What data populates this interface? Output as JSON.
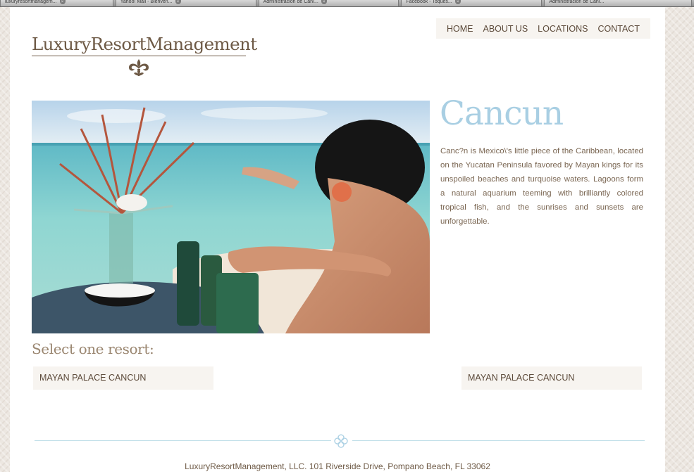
{
  "browser": {
    "tabs": [
      {
        "label": "luxuryresortmanagem..."
      },
      {
        "label": "Yahoo! Mail - Bienven..."
      },
      {
        "label": "Administración de Caní..."
      },
      {
        "label": "Facebook - Toques..."
      },
      {
        "label": "Administración de Caní..."
      }
    ]
  },
  "logo": {
    "text": "LuxuryResortManagement"
  },
  "nav": {
    "home": "HOME",
    "about": "ABOUT US",
    "locations": "LOCATIONS",
    "contact": "CONTACT"
  },
  "location": {
    "title": "Cancun",
    "description": "Canc?n is Mexico\\'s little piece of the Caribbean, located on the Yucatan Peninsula favored by Mayan kings for its unspoiled beaches and turquoise waters. Lagoons form a natural aquarium teeming with brilliantly colored tropical fish, and the sunrises and sunsets are unforgettable."
  },
  "select": {
    "heading": "Select one resort:",
    "resorts": [
      {
        "label": "MAYAN PALACE CANCUN"
      },
      {
        "label": "MAYAN PALACE CANCUN"
      }
    ]
  },
  "footer": {
    "address": "LuxuryResortManagement, LLC. 101 Riverside Drive, Pompano Beach, FL 33062"
  },
  "colors": {
    "accent": "#a9cfe3",
    "text_brown": "#6e5a46",
    "button_bg": "#f7f4f0"
  }
}
